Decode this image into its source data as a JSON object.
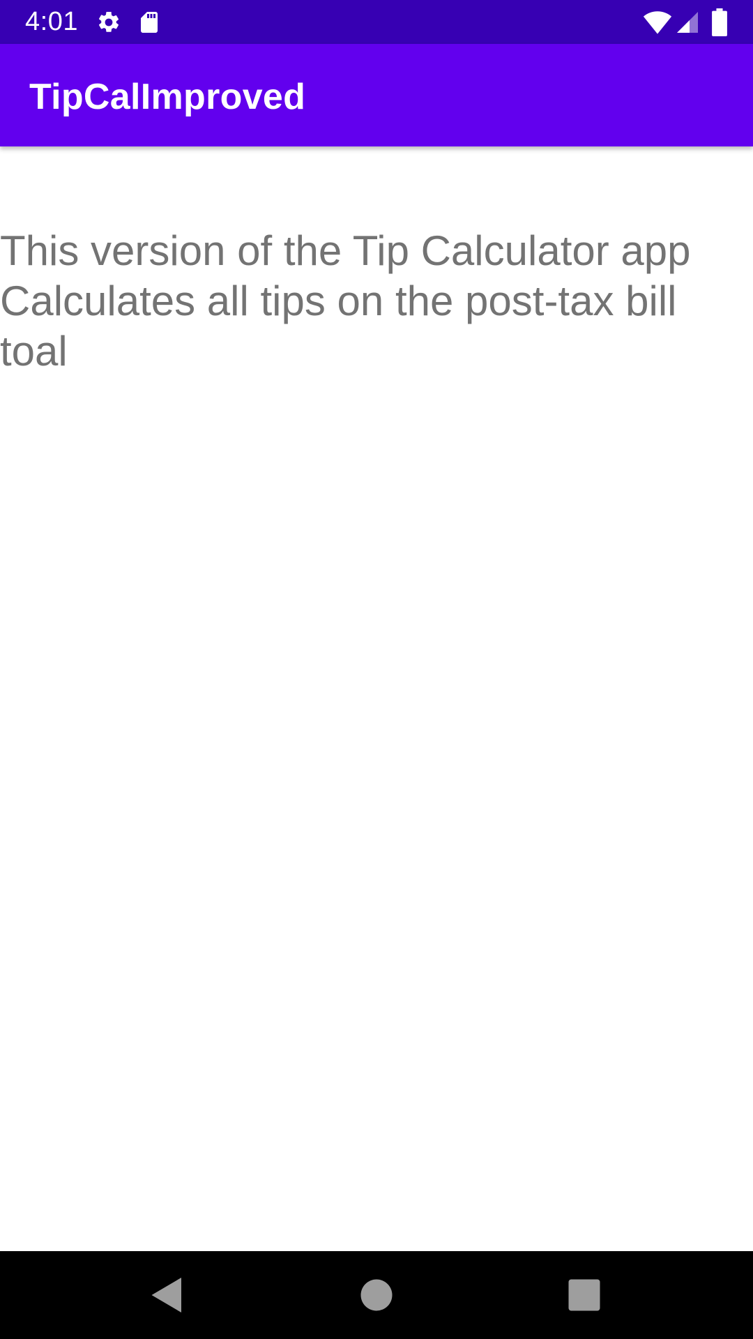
{
  "status_bar": {
    "time": "4:01",
    "icons": [
      "gear-icon",
      "sd-card-icon",
      "wifi-icon",
      "signal-icon",
      "battery-icon"
    ]
  },
  "app_bar": {
    "title": "TipCalImproved",
    "background": "#6200EE"
  },
  "main": {
    "description": "This version of the Tip Calculator app Calculates all tips on the post-tax bill toal"
  },
  "nav_bar": {
    "buttons": [
      "back-icon",
      "home-icon",
      "recents-icon"
    ]
  },
  "colors": {
    "status_bar": "#3700B3",
    "app_bar": "#6200EE",
    "text_secondary": "#737373"
  }
}
